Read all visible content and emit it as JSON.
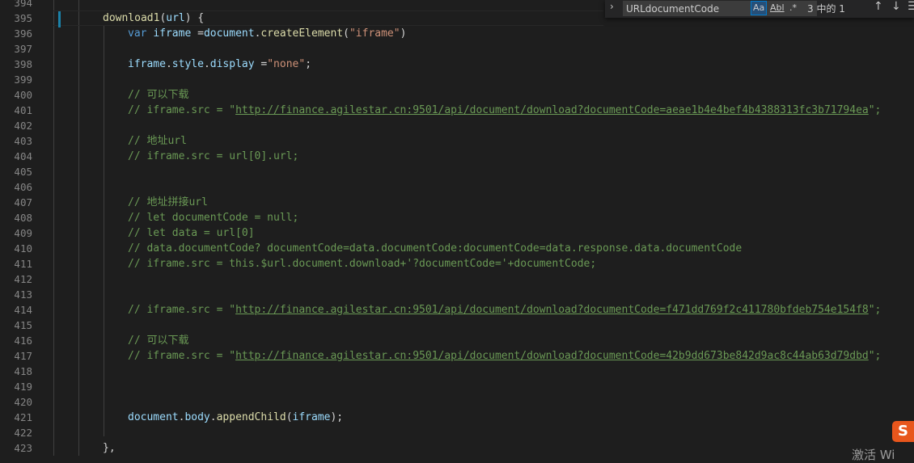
{
  "editor": {
    "lines": [
      {
        "n": "394",
        "indent": 0,
        "tokens": []
      },
      {
        "n": "395",
        "indent": 0,
        "tokens": [
          {
            "t": "download1",
            "c": "fn"
          },
          {
            "t": "(",
            "c": "punc"
          },
          {
            "t": "url",
            "c": "var"
          },
          {
            "t": ") {",
            "c": "punc"
          }
        ]
      },
      {
        "n": "396",
        "indent": 1,
        "tokens": [
          {
            "t": "var",
            "c": "kw"
          },
          {
            "t": " ",
            "c": "punc"
          },
          {
            "t": "iframe",
            "c": "var"
          },
          {
            "t": " =",
            "c": "punc"
          },
          {
            "t": "document",
            "c": "var"
          },
          {
            "t": ".",
            "c": "punc"
          },
          {
            "t": "createElement",
            "c": "fn"
          },
          {
            "t": "(",
            "c": "punc"
          },
          {
            "t": "\"iframe\"",
            "c": "str"
          },
          {
            "t": ")",
            "c": "punc"
          }
        ]
      },
      {
        "n": "397",
        "indent": 1,
        "tokens": []
      },
      {
        "n": "398",
        "indent": 1,
        "tokens": [
          {
            "t": "iframe",
            "c": "var"
          },
          {
            "t": ".",
            "c": "punc"
          },
          {
            "t": "style",
            "c": "var"
          },
          {
            "t": ".",
            "c": "punc"
          },
          {
            "t": "display",
            "c": "var"
          },
          {
            "t": " =",
            "c": "punc"
          },
          {
            "t": "\"none\"",
            "c": "str"
          },
          {
            "t": ";",
            "c": "punc"
          }
        ]
      },
      {
        "n": "399",
        "indent": 1,
        "tokens": []
      },
      {
        "n": "400",
        "indent": 1,
        "tokens": [
          {
            "t": "// 可以下载",
            "c": "cm"
          }
        ]
      },
      {
        "n": "401",
        "indent": 1,
        "tokens": [
          {
            "t": "// iframe.src = \"",
            "c": "cm"
          },
          {
            "t": "http://finance.agilestar.cn:9501/api/document/download?documentCode=aeae1b4e4bef4b4388313fc3b71794ea",
            "c": "url"
          },
          {
            "t": "\";",
            "c": "cm"
          }
        ]
      },
      {
        "n": "402",
        "indent": 1,
        "tokens": []
      },
      {
        "n": "403",
        "indent": 1,
        "tokens": [
          {
            "t": "// 地址url",
            "c": "cm"
          }
        ]
      },
      {
        "n": "404",
        "indent": 1,
        "tokens": [
          {
            "t": "// iframe.src = url[0].url;",
            "c": "cm"
          }
        ]
      },
      {
        "n": "405",
        "indent": 1,
        "tokens": []
      },
      {
        "n": "406",
        "indent": 1,
        "tokens": []
      },
      {
        "n": "407",
        "indent": 1,
        "tokens": [
          {
            "t": "// 地址拼接url",
            "c": "cm"
          }
        ]
      },
      {
        "n": "408",
        "indent": 1,
        "tokens": [
          {
            "t": "// let documentCode = null;",
            "c": "cm"
          }
        ]
      },
      {
        "n": "409",
        "indent": 1,
        "tokens": [
          {
            "t": "// let data = url[0]",
            "c": "cm"
          }
        ]
      },
      {
        "n": "410",
        "indent": 1,
        "tokens": [
          {
            "t": "// data.documentCode? documentCode=data.documentCode:documentCode=data.response.data.documentCode",
            "c": "cm"
          }
        ]
      },
      {
        "n": "411",
        "indent": 1,
        "tokens": [
          {
            "t": "// iframe.src = this.$url.document.download+'?documentCode='+documentCode;",
            "c": "cm"
          }
        ]
      },
      {
        "n": "412",
        "indent": 1,
        "tokens": []
      },
      {
        "n": "413",
        "indent": 1,
        "tokens": []
      },
      {
        "n": "414",
        "indent": 1,
        "tokens": [
          {
            "t": "// iframe.src = \"",
            "c": "cm"
          },
          {
            "t": "http://finance.agilestar.cn:9501/api/document/download?documentCode=f471dd769f2c411780bfdeb754e154f8",
            "c": "url"
          },
          {
            "t": "\";",
            "c": "cm"
          }
        ]
      },
      {
        "n": "415",
        "indent": 1,
        "tokens": []
      },
      {
        "n": "416",
        "indent": 1,
        "tokens": [
          {
            "t": "// 可以下载",
            "c": "cm"
          }
        ]
      },
      {
        "n": "417",
        "indent": 1,
        "tokens": [
          {
            "t": "// iframe.src = \"",
            "c": "cm"
          },
          {
            "t": "http://finance.agilestar.cn:9501/api/document/download?documentCode=42b9dd673be842d9ac8c44ab63d79dbd",
            "c": "url"
          },
          {
            "t": "\";",
            "c": "cm"
          }
        ]
      },
      {
        "n": "418",
        "indent": 1,
        "tokens": []
      },
      {
        "n": "419",
        "indent": 1,
        "tokens": []
      },
      {
        "n": "420",
        "indent": 1,
        "tokens": []
      },
      {
        "n": "421",
        "indent": 1,
        "tokens": [
          {
            "t": "document",
            "c": "var"
          },
          {
            "t": ".",
            "c": "punc"
          },
          {
            "t": "body",
            "c": "var"
          },
          {
            "t": ".",
            "c": "punc"
          },
          {
            "t": "appendChild",
            "c": "fn"
          },
          {
            "t": "(",
            "c": "punc"
          },
          {
            "t": "iframe",
            "c": "var"
          },
          {
            "t": ");",
            "c": "punc"
          }
        ]
      },
      {
        "n": "422",
        "indent": 1,
        "tokens": []
      },
      {
        "n": "423",
        "indent": 0,
        "tokens": [
          {
            "t": "},",
            "c": "punc"
          }
        ]
      }
    ]
  },
  "find": {
    "query": "URLdocumentCode",
    "match_case_label": "Aa",
    "whole_word_label": "Abl",
    "regex_label": ".*",
    "match_count": "3 中的 1",
    "toggle_glyph": "›",
    "prev_glyph": "↑",
    "next_glyph": "↓",
    "menu_glyph": "☰"
  },
  "overlay": {
    "ime_label": "S",
    "watermark": "激活 Wi"
  },
  "colors": {
    "background": "#1e1e1e",
    "comment": "#6a9955",
    "string": "#ce9178",
    "keyword": "#569cd6",
    "variable": "#9cdcfe",
    "function": "#dcdcaa"
  }
}
